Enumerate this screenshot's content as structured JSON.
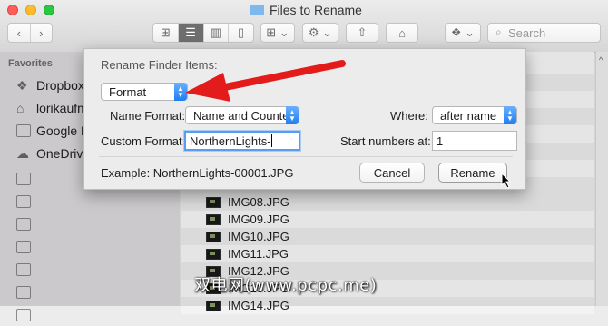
{
  "window": {
    "title": "Files to Rename"
  },
  "toolbar": {
    "search_placeholder": "Search"
  },
  "sidebar": {
    "heading": "Favorites",
    "items": [
      {
        "label": "Dropbox",
        "icon": "dropbox-icon"
      },
      {
        "label": "lorikaufm",
        "icon": "home-icon"
      },
      {
        "label": "Google D",
        "icon": "folder-icon"
      },
      {
        "label": "OneDrive",
        "icon": "cloud-icon"
      },
      {
        "label": "",
        "icon": "folder-icon"
      },
      {
        "label": "",
        "icon": "folder-icon"
      },
      {
        "label": "",
        "icon": "folder-icon"
      },
      {
        "label": "",
        "icon": "folder-icon"
      },
      {
        "label": "",
        "icon": "folder-icon"
      },
      {
        "label": "",
        "icon": "folder-icon"
      },
      {
        "label": "",
        "icon": "folder-icon"
      }
    ]
  },
  "files": [
    "IMG08.JPG",
    "IMG09.JPG",
    "IMG10.JPG",
    "IMG11.JPG",
    "IMG12.JPG",
    "IMG13.JPG",
    "IMG14.JPG"
  ],
  "dialog": {
    "title": "Rename Finder Items:",
    "mode_select": "Format",
    "name_format_label": "Name Format:",
    "name_format_value": "Name and Counter",
    "where_label": "Where:",
    "where_value": "after name",
    "custom_format_label": "Custom Format:",
    "custom_format_value": "NorthernLights-",
    "start_numbers_label": "Start numbers at:",
    "start_numbers_value": "1",
    "example": "Example: NorthernLights-00001.JPG",
    "cancel_label": "Cancel",
    "rename_label": "Rename"
  },
  "watermark": "双电网(www.pcpc.me)",
  "colors": {
    "accent": "#1f7df0",
    "annotation_arrow": "#e31b1b"
  }
}
